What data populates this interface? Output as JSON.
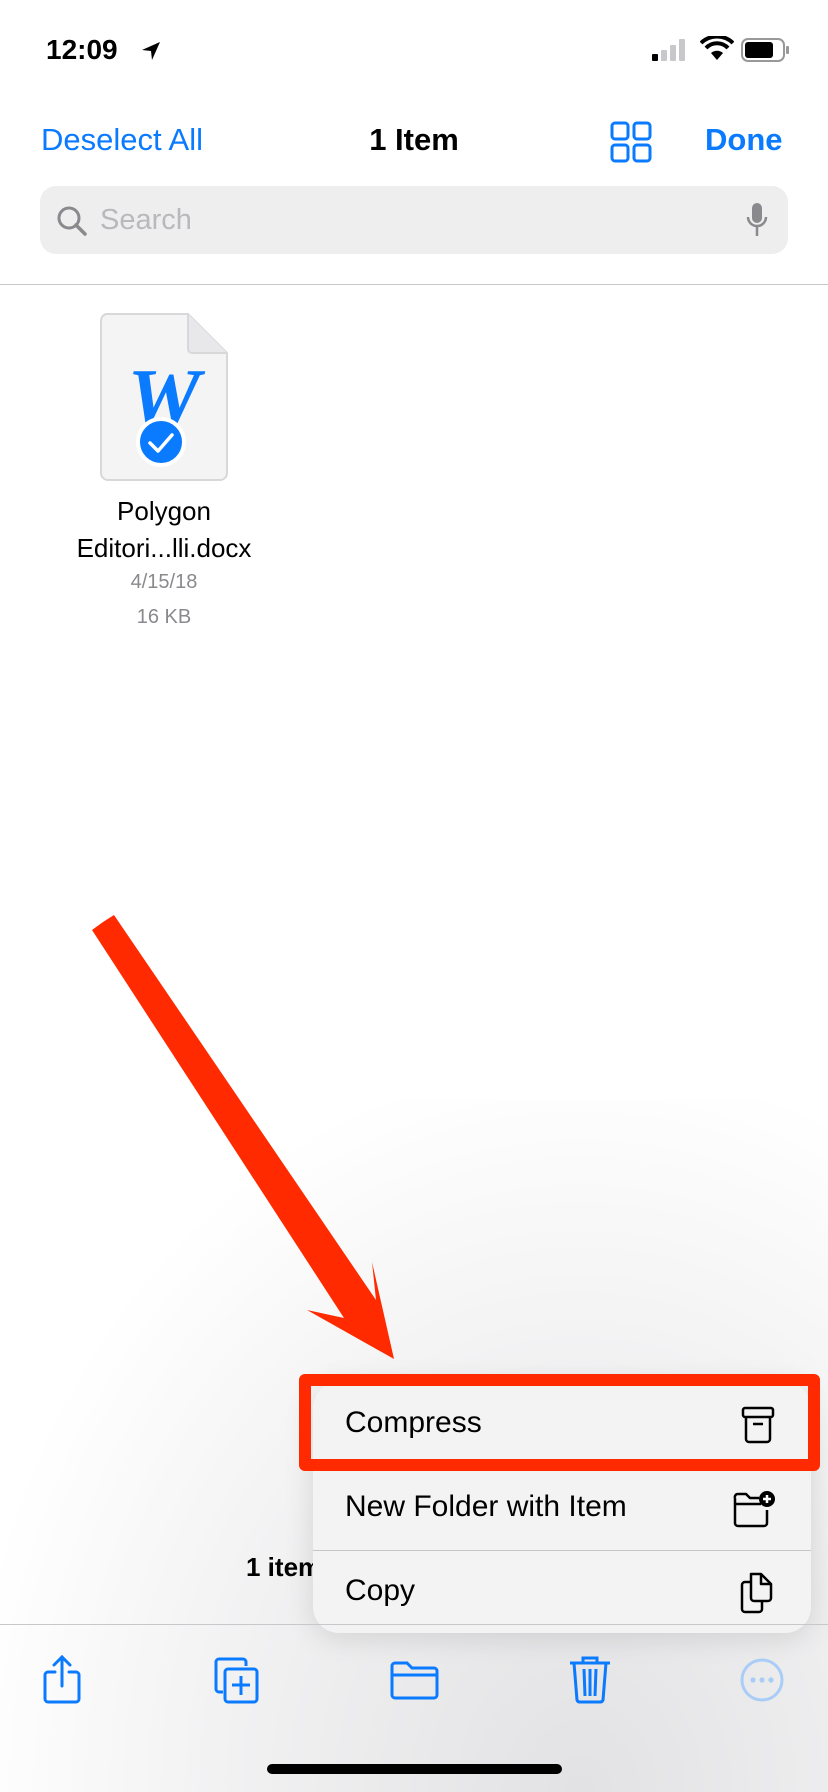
{
  "status_bar": {
    "time": "12:09",
    "icons": [
      "location-arrow-icon",
      "cellular-signal-icon",
      "wifi-icon",
      "battery-icon"
    ]
  },
  "nav": {
    "deselect_all": "Deselect All",
    "title": "1 Item",
    "grid_icon": "grid-view-icon",
    "done": "Done"
  },
  "search": {
    "placeholder": "Search",
    "icons": [
      "search-icon",
      "microphone-icon"
    ]
  },
  "file": {
    "name_line1": "Polygon",
    "name_line2": "Editori...lli.docx",
    "date": "4/15/18",
    "size": "16 KB",
    "selected": true
  },
  "footer": {
    "count": "1 item"
  },
  "context_menu": {
    "items": [
      {
        "label": "Compress",
        "icon": "archive-box-icon"
      },
      {
        "label": "New Folder with Item",
        "icon": "folder-badge-plus-icon"
      },
      {
        "label": "Copy",
        "icon": "copy-documents-icon"
      }
    ]
  },
  "toolbar": {
    "icons": [
      "share-icon",
      "duplicate-icon",
      "move-folder-icon",
      "trash-icon",
      "more-ellipsis-icon"
    ]
  },
  "colors": {
    "accent": "#0a7aff",
    "annotation": "#ff2a00"
  }
}
